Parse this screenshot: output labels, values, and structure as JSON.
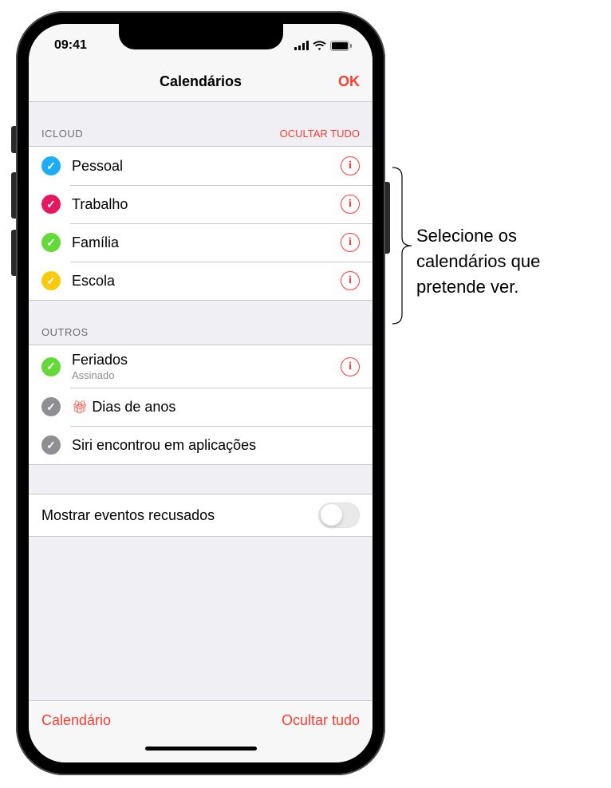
{
  "status": {
    "time": "09:41"
  },
  "nav": {
    "title": "Calendários",
    "done": "OK"
  },
  "sections": {
    "icloud": {
      "header": "ICLOUD",
      "action": "OCULTAR TUDO",
      "items": [
        {
          "label": "Pessoal",
          "color": "#1badf8"
        },
        {
          "label": "Trabalho",
          "color": "#e6185f"
        },
        {
          "label": "Família",
          "color": "#63da38"
        },
        {
          "label": "Escola",
          "color": "#f8cc0a"
        }
      ]
    },
    "outros": {
      "header": "OUTROS",
      "items": [
        {
          "label": "Feriados",
          "sublabel": "Assinado",
          "color": "#63da38",
          "info": true
        },
        {
          "label": "Dias de anos",
          "color": "#8e8e93",
          "gift": true
        },
        {
          "label": "Siri encontrou em aplicações",
          "color": "#8e8e93"
        }
      ]
    }
  },
  "toggle": {
    "label": "Mostrar eventos recusados",
    "on": false
  },
  "toolbar": {
    "left": "Calendário",
    "right": "Ocultar tudo"
  },
  "callout": {
    "text": "Selecione os calendários que pretende ver."
  }
}
